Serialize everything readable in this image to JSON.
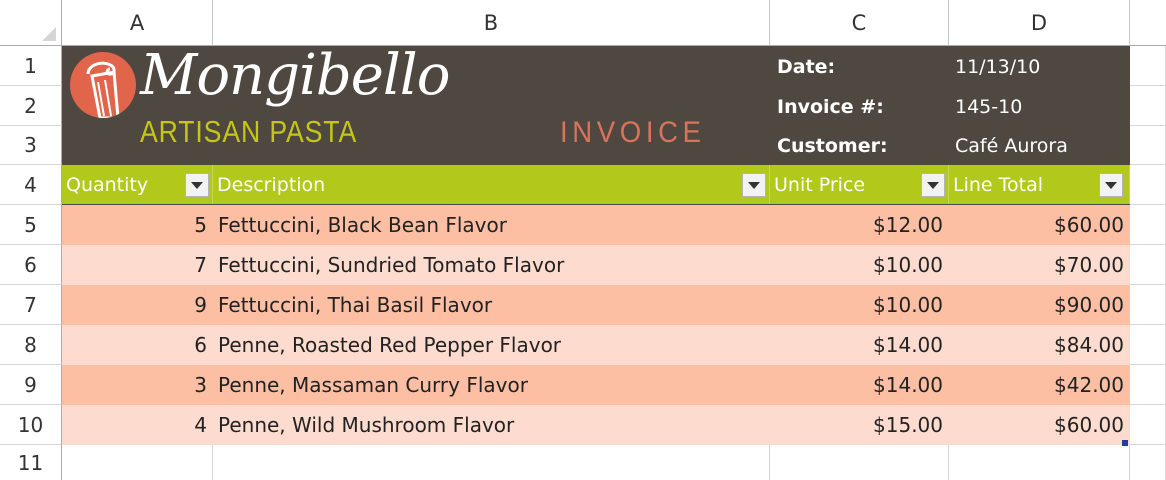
{
  "columns": [
    "A",
    "B",
    "C",
    "D"
  ],
  "rows": [
    "1",
    "2",
    "3",
    "4",
    "5",
    "6",
    "7",
    "8",
    "9",
    "10",
    "11"
  ],
  "logo": {
    "name": "Mongibello",
    "subtitle": "ARTISAN PASTA"
  },
  "invoice_title": "INVOICE",
  "info": {
    "date_label": "Date:",
    "date_value": "11/13/10",
    "invoice_label": "Invoice #:",
    "invoice_value": "145-10",
    "customer_label": "Customer:",
    "customer_value": "Café Aurora"
  },
  "table": {
    "headers": [
      "Quantity",
      "Description",
      "Unit Price",
      "Line Total"
    ],
    "rows": [
      {
        "qty": "5",
        "desc": "Fettuccini, Black Bean Flavor",
        "price": "$12.00",
        "total": "$60.00"
      },
      {
        "qty": "7",
        "desc": "Fettuccini, Sundried Tomato Flavor",
        "price": "$10.00",
        "total": "$70.00"
      },
      {
        "qty": "9",
        "desc": "Fettuccini, Thai Basil Flavor",
        "price": "$10.00",
        "total": "$90.00"
      },
      {
        "qty": "6",
        "desc": "Penne, Roasted Red Pepper Flavor",
        "price": "$14.00",
        "total": "$84.00"
      },
      {
        "qty": "3",
        "desc": "Penne, Massaman Curry Flavor",
        "price": "$14.00",
        "total": "$42.00"
      },
      {
        "qty": "4",
        "desc": "Penne, Wild Mushroom Flavor",
        "price": "$15.00",
        "total": "$60.00"
      }
    ]
  },
  "colors": {
    "banner": "#4f4841",
    "header_green": "#b2c81a",
    "row_dark": "#fcbfa4",
    "row_light": "#fddccf",
    "logo_orange": "#e0654a",
    "subtitle_green": "#c6c619"
  }
}
